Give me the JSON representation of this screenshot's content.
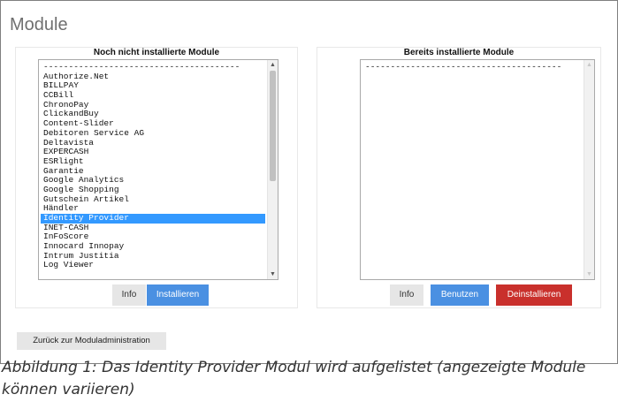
{
  "page": {
    "title": "Module",
    "back_label": "Zurück zur Moduladministration",
    "caption": "Abbildung 1: Das Identity Provider Modul wird aufgelistet (angezeigte Module können variieren)"
  },
  "left_panel": {
    "title": "Noch nicht installierte Module",
    "selected": "Identity Provider",
    "items": [
      "---------------------------------------",
      "Authorize.Net",
      "BILLPAY",
      "CCBill",
      "ChronoPay",
      "ClickandBuy",
      "Content-Slider",
      "Debitoren Service AG",
      "Deltavista",
      "EXPERCASH",
      "ESRlight",
      "Garantie",
      "Google Analytics",
      "Google Shopping",
      "Gutschein Artikel",
      "Händler",
      "Identity Provider",
      "INET-CASH",
      "InFoScore",
      "Innocard Innopay",
      "Intrum Justitia",
      "Log Viewer"
    ],
    "info_label": "Info",
    "install_label": "Installieren"
  },
  "right_panel": {
    "title": "Bereits installierte Module",
    "items": [
      "---------------------------------------"
    ],
    "info_label": "Info",
    "use_label": "Benutzen",
    "uninstall_label": "Deinstallieren"
  },
  "colors": {
    "selection": "#3399ff",
    "primary_button": "#4a90e2",
    "danger_button": "#c9302c",
    "neutral_button": "#e6e6e6"
  },
  "icons": {
    "scroll_up": "chevron-up-icon",
    "scroll_down": "chevron-down-icon"
  }
}
